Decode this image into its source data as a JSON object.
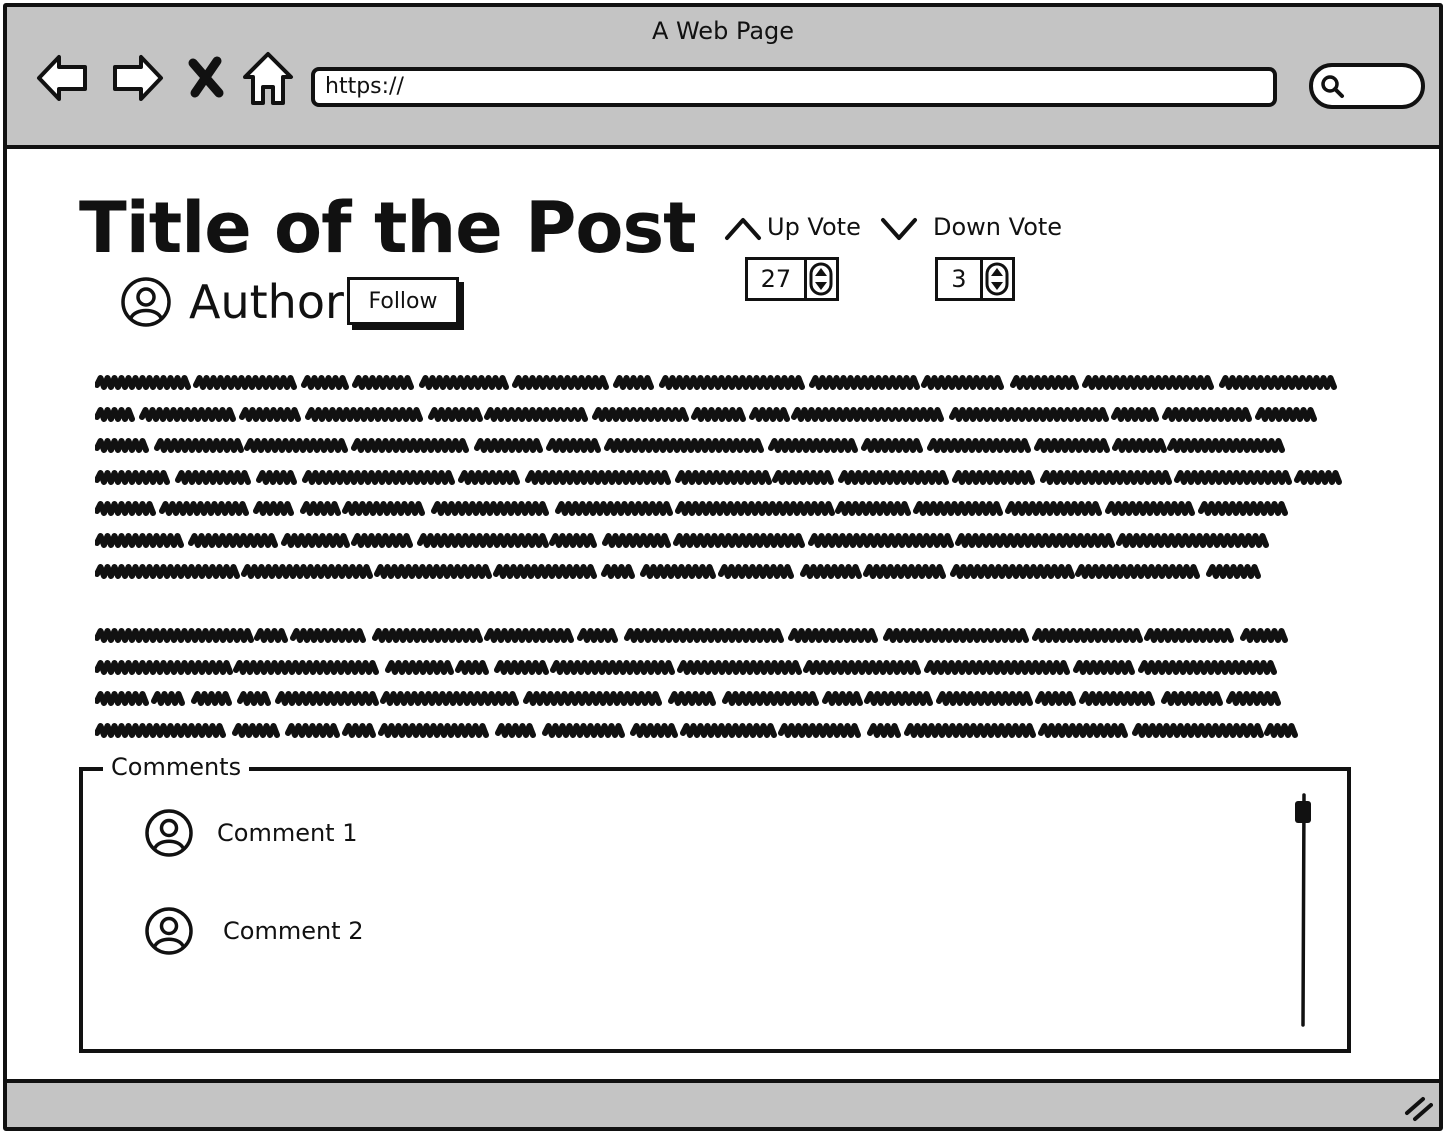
{
  "window": {
    "title": "A Web Page"
  },
  "toolbar": {
    "back_icon": "back-arrow-icon",
    "forward_icon": "forward-arrow-icon",
    "stop_icon": "close-x-icon",
    "home_icon": "home-icon",
    "url": "https://",
    "search_icon": "search-icon"
  },
  "post": {
    "title": "Title of the Post",
    "author": "Author",
    "follow_label": "Follow",
    "up_vote": {
      "label": "Up Vote",
      "count": "27"
    },
    "down_vote": {
      "label": "Down Vote",
      "count": "3"
    }
  },
  "comments": {
    "legend": "Comments",
    "items": [
      {
        "text": "Comment 1"
      },
      {
        "text": "Comment 2"
      }
    ]
  },
  "colors": {
    "chrome": "#c4c4c4",
    "ink": "#111111",
    "background": "#ffffff"
  }
}
